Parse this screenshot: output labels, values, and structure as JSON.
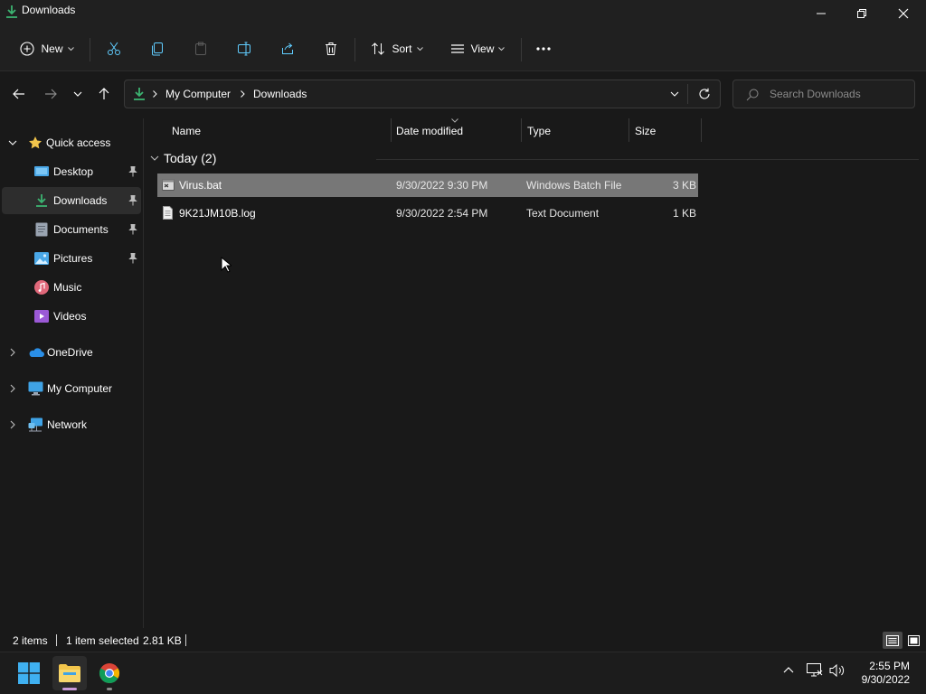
{
  "window": {
    "title": "Downloads"
  },
  "toolbar": {
    "new_label": "New",
    "sort_label": "Sort",
    "view_label": "View"
  },
  "address": {
    "crumbs": [
      "My Computer",
      "Downloads"
    ]
  },
  "search": {
    "placeholder": "Search Downloads"
  },
  "sidebar": {
    "quick_access": "Quick access",
    "items": [
      {
        "label": "Desktop",
        "icon": "desktop-icon",
        "pinned": true
      },
      {
        "label": "Downloads",
        "icon": "downloads-icon",
        "pinned": true,
        "selected": true
      },
      {
        "label": "Documents",
        "icon": "documents-icon",
        "pinned": true
      },
      {
        "label": "Pictures",
        "icon": "pictures-icon",
        "pinned": true
      },
      {
        "label": "Music",
        "icon": "music-icon",
        "pinned": false
      },
      {
        "label": "Videos",
        "icon": "videos-icon",
        "pinned": false
      }
    ],
    "roots": [
      {
        "label": "OneDrive",
        "icon": "onedrive-icon"
      },
      {
        "label": "My Computer",
        "icon": "computer-icon"
      },
      {
        "label": "Network",
        "icon": "network-icon"
      }
    ]
  },
  "columns": [
    "Name",
    "Date modified",
    "Type",
    "Size"
  ],
  "group": {
    "label": "Today (2)"
  },
  "files": [
    {
      "name": "Virus.bat",
      "date": "9/30/2022 9:30 PM",
      "type": "Windows Batch File",
      "size": "3 KB",
      "selected": true
    },
    {
      "name": "9K21JM10B.log",
      "date": "9/30/2022 2:54 PM",
      "type": "Text Document",
      "size": "1 KB",
      "selected": false
    }
  ],
  "status": {
    "items": "2 items",
    "selection": "1 item selected",
    "selection_size": "2.81 KB"
  },
  "clock": {
    "time": "2:55 PM",
    "date": "9/30/2022"
  },
  "colors": {
    "accent": "#60cdff",
    "folder": "#f2c54b",
    "selection_row": "#777777",
    "download_green": "#3cb371"
  }
}
